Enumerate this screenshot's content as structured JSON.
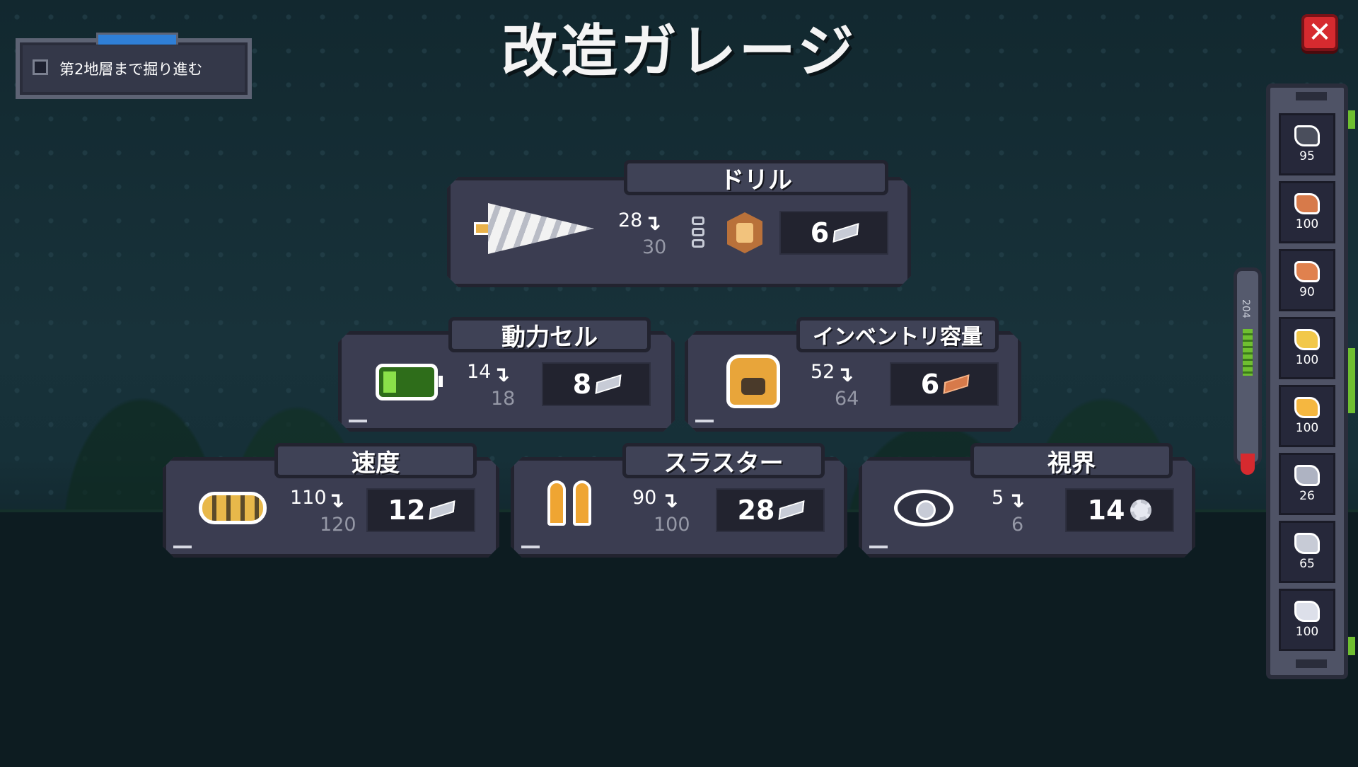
{
  "title": "改造ガレージ",
  "quest": {
    "label": "第2地層まで掘り進む"
  },
  "close_button": {
    "label": "✕"
  },
  "upgrades": {
    "drill": {
      "name": "ドリル",
      "current": "28",
      "next": "30",
      "cost": "6",
      "cost_icon": "iron-ingot-icon"
    },
    "power": {
      "name": "動力セル",
      "current": "14",
      "next": "18",
      "cost": "8",
      "cost_icon": "iron-ingot-icon"
    },
    "inventory": {
      "name": "インベントリ容量",
      "current": "52",
      "next": "64",
      "cost": "6",
      "cost_icon": "copper-ingot-icon"
    },
    "speed": {
      "name": "速度",
      "current": "110",
      "next": "120",
      "cost": "12",
      "cost_icon": "iron-ingot-icon"
    },
    "thruster": {
      "name": "スラスター",
      "current": "90",
      "next": "100",
      "cost": "28",
      "cost_icon": "iron-ingot-icon"
    },
    "vision": {
      "name": "視界",
      "current": "5",
      "next": "6",
      "cost": "14",
      "cost_icon": "gear-icon"
    }
  },
  "arrow_glyph": "↴",
  "inventory": [
    {
      "icon": "coal-ore-icon",
      "count": "95",
      "color": "#4a4e5c"
    },
    {
      "icon": "copper-ore-icon",
      "count": "100",
      "color": "#d77a4a"
    },
    {
      "icon": "copper-ingot-icon",
      "count": "90",
      "color": "#e0814e"
    },
    {
      "icon": "gold-ore-icon",
      "count": "100",
      "color": "#f2c84a"
    },
    {
      "icon": "gold-ingot-icon",
      "count": "100",
      "color": "#f5b740"
    },
    {
      "icon": "iron-ore-icon",
      "count": "26",
      "color": "#aeb3c2"
    },
    {
      "icon": "iron-ingot-icon",
      "count": "65",
      "color": "#c7cbd6"
    },
    {
      "icon": "crystal-icon",
      "count": "100",
      "color": "#dde0ea"
    }
  ],
  "fuel_gauge": {
    "label": "204"
  },
  "colors": {
    "accent_green": "#6fbf31",
    "close_red": "#d62a2f",
    "panel": "#3b3d51"
  }
}
